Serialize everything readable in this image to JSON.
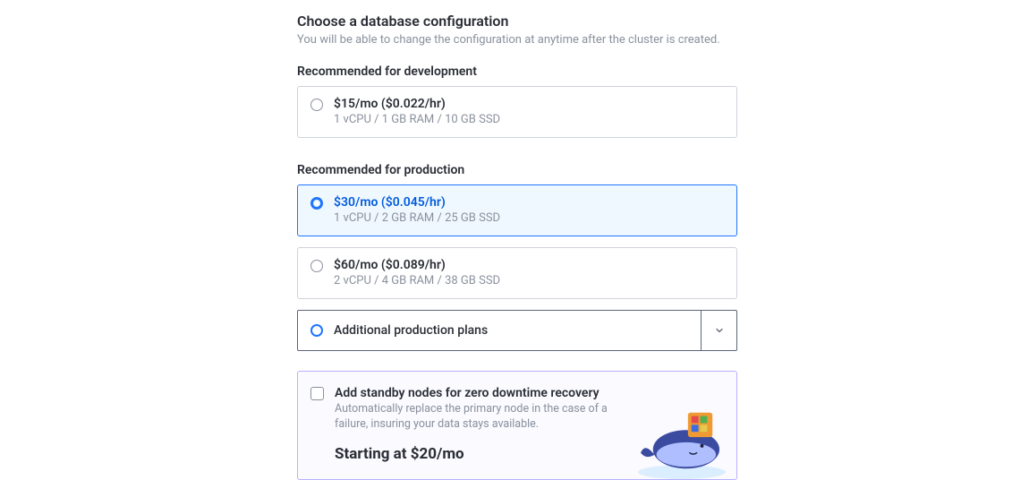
{
  "header": {
    "title": "Choose a database configuration",
    "subtitle": "You will be able to change the configuration at anytime after the cluster is created."
  },
  "dev": {
    "label": "Recommended for development",
    "plans": [
      {
        "price": "$15/mo ($0.022/hr)",
        "specs": "1 vCPU / 1 GB RAM / 10 GB SSD",
        "selected": false
      }
    ]
  },
  "prod": {
    "label": "Recommended for production",
    "plans": [
      {
        "price": "$30/mo ($0.045/hr)",
        "specs": "1 vCPU / 2 GB RAM / 25 GB SSD",
        "selected": true
      },
      {
        "price": "$60/mo ($0.089/hr)",
        "specs": "2 vCPU / 4 GB RAM / 38 GB SSD",
        "selected": false
      }
    ],
    "additional": {
      "label": "Additional production plans"
    }
  },
  "standby": {
    "title": "Add standby nodes for zero downtime recovery",
    "desc": "Automatically replace the primary node in the case of a failure, insuring your data stays available.",
    "price": "Starting at $20/mo"
  }
}
